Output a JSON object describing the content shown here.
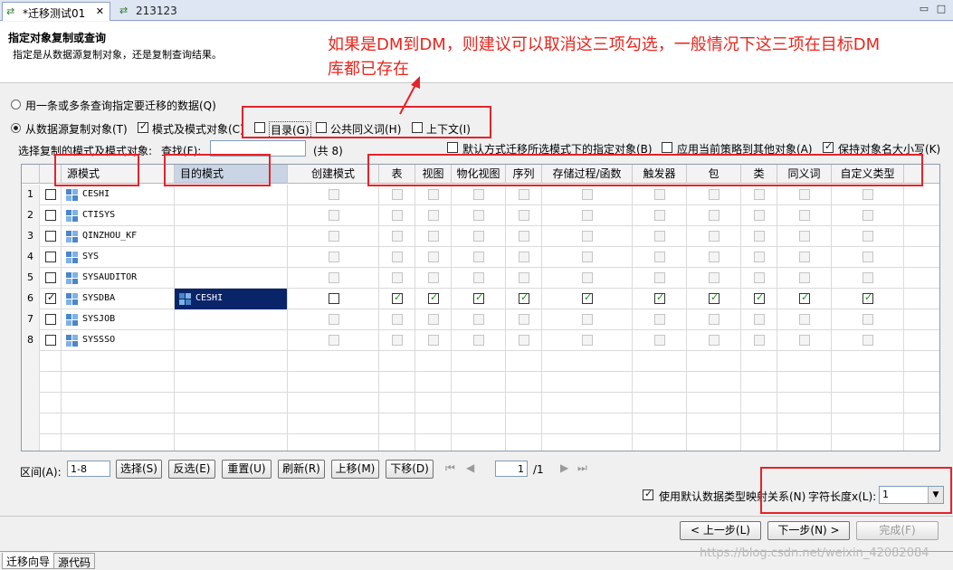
{
  "tabs": [
    {
      "label": "*迁移测试01"
    },
    {
      "label": "213123"
    }
  ],
  "header": {
    "title": "指定对象复制或查询",
    "description": "指定是从数据源复制对象，还是复制查询结果。"
  },
  "annotation": {
    "text": "如果是DM到DM，则建议可以取消这三项勾选，一般情况下这三项在目标DM库都已存在",
    "color": "#e8261e"
  },
  "options": {
    "radio_query": "用一条或多条查询指定要迁移的数据(Q)",
    "radio_copy": "从数据源复制对象(T)",
    "cb_schema": "模式及模式对象(C)",
    "cb_catalog": "目录(G)",
    "cb_synonym": "公共同义词(H)",
    "cb_context": "上下文(I)",
    "select_label": "选择复制的模式及模式对象:",
    "find_label": "查找(F):",
    "find_value": "",
    "count_text": "(共 8)",
    "cb_default": "默认方式迁移所选模式下的指定对象(B)",
    "cb_apply": "应用当前策略到其他对象(A)",
    "cb_keepcase": "保持对象名大小写(K)"
  },
  "grid": {
    "columns": [
      "源模式",
      "目的模式",
      "创建模式",
      "表",
      "视图",
      "物化视图",
      "序列",
      "存储过程/函数",
      "触发器",
      "包",
      "类",
      "同义词",
      "自定义类型"
    ],
    "rows": [
      {
        "num": "1",
        "selected": false,
        "source": "CESHI",
        "target": ""
      },
      {
        "num": "2",
        "selected": false,
        "source": "CTISYS",
        "target": ""
      },
      {
        "num": "3",
        "selected": false,
        "source": "QINZHOU_KF",
        "target": ""
      },
      {
        "num": "4",
        "selected": false,
        "source": "SYS",
        "target": ""
      },
      {
        "num": "5",
        "selected": false,
        "source": "SYSAUDITOR",
        "target": ""
      },
      {
        "num": "6",
        "selected": true,
        "source": "SYSDBA",
        "target": "CESHI"
      },
      {
        "num": "7",
        "selected": false,
        "source": "SYSJOB",
        "target": ""
      },
      {
        "num": "8",
        "selected": false,
        "source": "SYSSSO",
        "target": ""
      }
    ]
  },
  "toolbar": {
    "range_label": "区间(A):",
    "range_value": "1-8",
    "select": "选择(S)",
    "invert": "反选(E)",
    "reset": "重置(U)",
    "refresh": "刷新(R)",
    "up": "上移(M)",
    "down": "下移(D)",
    "page_value": "1",
    "page_total": "/1"
  },
  "mapping": {
    "cb_label": "使用默认数据类型映射关系(N)",
    "len_label": "字符长度x(L):",
    "len_value": "1"
  },
  "footer": {
    "prev": "< 上一步(L)",
    "next": "下一步(N) >",
    "finish": "完成(F)"
  },
  "bottom_tabs": [
    "迁移向导",
    "源代码"
  ],
  "watermark": "https://blog.csdn.net/weixin_42082084"
}
